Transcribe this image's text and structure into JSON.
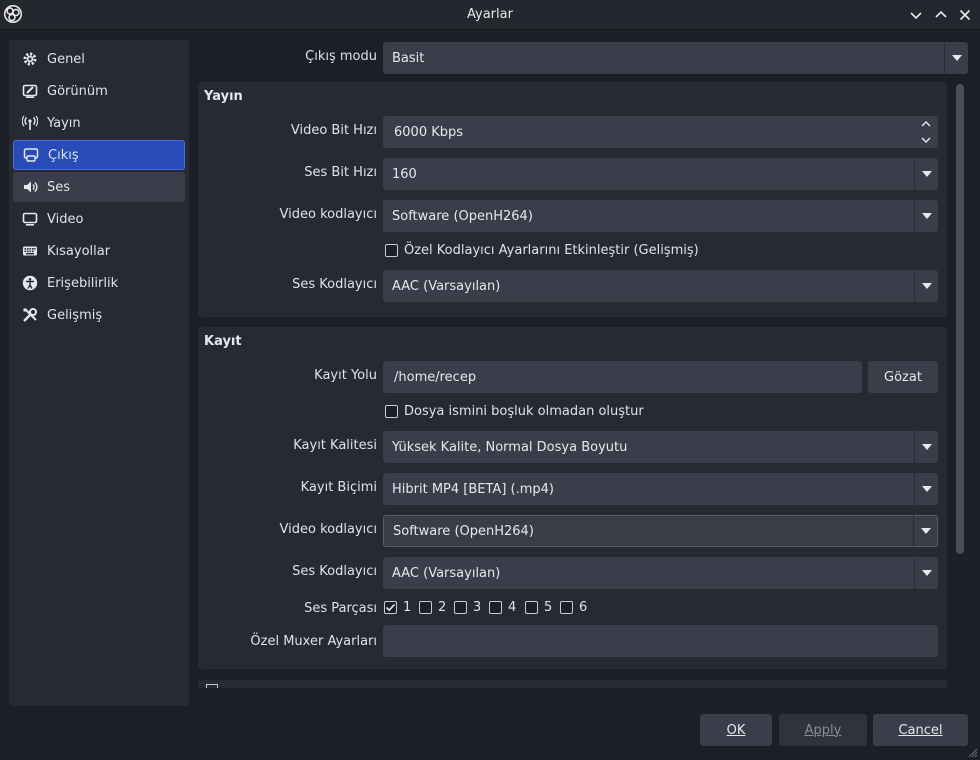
{
  "window": {
    "title": "Ayarlar"
  },
  "sidebar": {
    "items": [
      {
        "label": "Genel",
        "icon": "gear-icon"
      },
      {
        "label": "Görünüm",
        "icon": "appearance-icon"
      },
      {
        "label": "Yayın",
        "icon": "antenna-icon"
      },
      {
        "label": "Çıkış",
        "icon": "output-icon"
      },
      {
        "label": "Ses",
        "icon": "speaker-icon"
      },
      {
        "label": "Video",
        "icon": "monitor-icon"
      },
      {
        "label": "Kısayollar",
        "icon": "keyboard-icon"
      },
      {
        "label": "Erişebilirlik",
        "icon": "accessibility-icon"
      },
      {
        "label": "Gelişmiş",
        "icon": "tools-icon"
      }
    ],
    "active": "Çıkış"
  },
  "output": {
    "mode_label": "Çıkış modu",
    "mode_value": "Basit"
  },
  "stream": {
    "title": "Yayın",
    "video_bitrate_label": "Video Bit Hızı",
    "video_bitrate_value": "6000 Kbps",
    "audio_bitrate_label": "Ses Bit Hızı",
    "audio_bitrate_value": "160",
    "video_encoder_label": "Video kodlayıcı",
    "video_encoder_value": "Software (OpenH264)",
    "custom_encoder_label": "Özel Kodlayıcı Ayarlarını Etkinleştir (Gelişmiş)",
    "audio_encoder_label": "Ses Kodlayıcı",
    "audio_encoder_value": "AAC (Varsayılan)"
  },
  "recording": {
    "title": "Kayıt",
    "path_label": "Kayıt Yolu",
    "path_value": "/home/recep",
    "browse_label": "Gözat",
    "no_space_label": "Dosya ismini boşluk olmadan oluştur",
    "quality_label": "Kayıt Kalitesi",
    "quality_value": "Yüksek Kalite, Normal Dosya Boyutu",
    "format_label": "Kayıt Biçimi",
    "format_value": "Hibrit MP4 [BETA] (.mp4)",
    "video_encoder_label": "Video kodlayıcı",
    "video_encoder_value": "Software (OpenH264)",
    "audio_encoder_label": "Ses Kodlayıcı",
    "audio_encoder_value": "AAC (Varsayılan)",
    "tracks_label": "Ses Parçası",
    "tracks": [
      {
        "label": "1",
        "checked": true
      },
      {
        "label": "2",
        "checked": false
      },
      {
        "label": "3",
        "checked": false
      },
      {
        "label": "4",
        "checked": false
      },
      {
        "label": "5",
        "checked": false
      },
      {
        "label": "6",
        "checked": false
      }
    ],
    "muxer_label": "Özel Muxer Ayarları",
    "muxer_value": ""
  },
  "buttons": {
    "ok": "OK",
    "apply": "Apply",
    "cancel": "Cancel"
  },
  "colors": {
    "accent": "#284cb8",
    "background": "#1d1f26",
    "panel": "#282a33",
    "field": "#3b3e4a"
  }
}
